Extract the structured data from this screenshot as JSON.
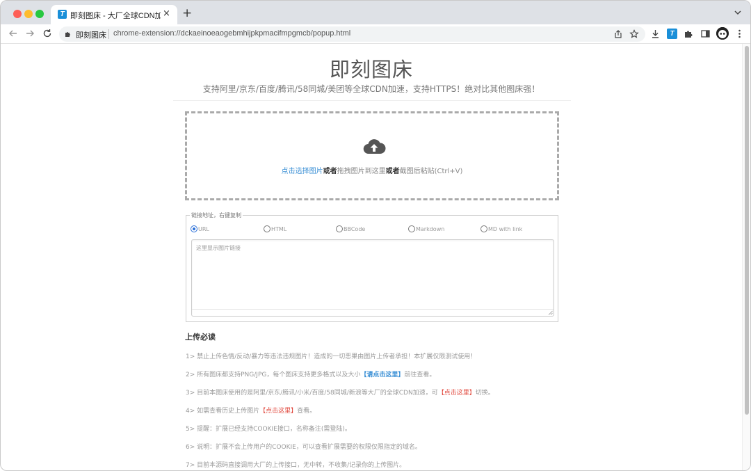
{
  "browser": {
    "tab": {
      "favicon": "T",
      "title": "即刻图床 - 大厂全球CDN加速",
      "close_icon": "×"
    },
    "new_tab_icon": "+",
    "omnibox": {
      "site_name": "即刻图床",
      "url": "chrome-extension://dckaeinoeaogebmhijpkpmacifmpgmcb/popup.html"
    },
    "extension_badge": "T"
  },
  "app": {
    "title": "即刻图床",
    "subtitle": "支持阿里/京东/百度/腾讯/58同城/美团等全球CDN加速，支持HTTPS！绝对比其他图床强！"
  },
  "dropzone": {
    "select_link": "点击选择图片",
    "or1": "或者",
    "drag_text": "拖拽图片到这里",
    "or2": "或者",
    "paste_text": "截图后粘贴(Ctrl+V)"
  },
  "links": {
    "legend": "链接地址，右键复制",
    "formats": [
      {
        "label": "URL",
        "checked": true
      },
      {
        "label": "HTML",
        "checked": false
      },
      {
        "label": "BBCode",
        "checked": false
      },
      {
        "label": "Markdown",
        "checked": false
      },
      {
        "label": "MD with link",
        "checked": false
      }
    ],
    "placeholder": "这里显示图片链接"
  },
  "notes": {
    "title": "上传必读",
    "n1": "1> 禁止上传色情/反动/暴力等违法违规图片！造成的一切恶果由图片上传者承担！本扩展仅限测试使用！",
    "n2_pre": "2> 所有图床都支持PNG/JPG，每个图床支持更多格式以及大小",
    "n2_link": "【请点击这里】",
    "n2_post": "前往查看。",
    "n3_pre": "3> 目前本图床使用的是阿里/京东/腾讯/小米/百度/58同城/新浪等大厂的全球CDN加速，可",
    "n3_link": "【点击这里】",
    "n3_post": "切换。",
    "n4_pre": "4> 如需查看历史上传图片",
    "n4_link": "【点击这里】",
    "n4_post": "查看。",
    "n5": "5> 提醒：扩展已经支持COOKIE接口，名称备注(需登陆)。",
    "n6": "6> 说明：扩展不会上传用户的COOKIE，可以查看扩展需要的权限仅限指定的域名。",
    "n7": "7> 目前本源码直接调用大厂的上传接口，无中转，不收集/记录你的上传图片。"
  },
  "colors": {
    "accent_blue": "#3a8fd5",
    "accent_red": "#e0453a",
    "extension_blue": "#1a8fd8"
  }
}
